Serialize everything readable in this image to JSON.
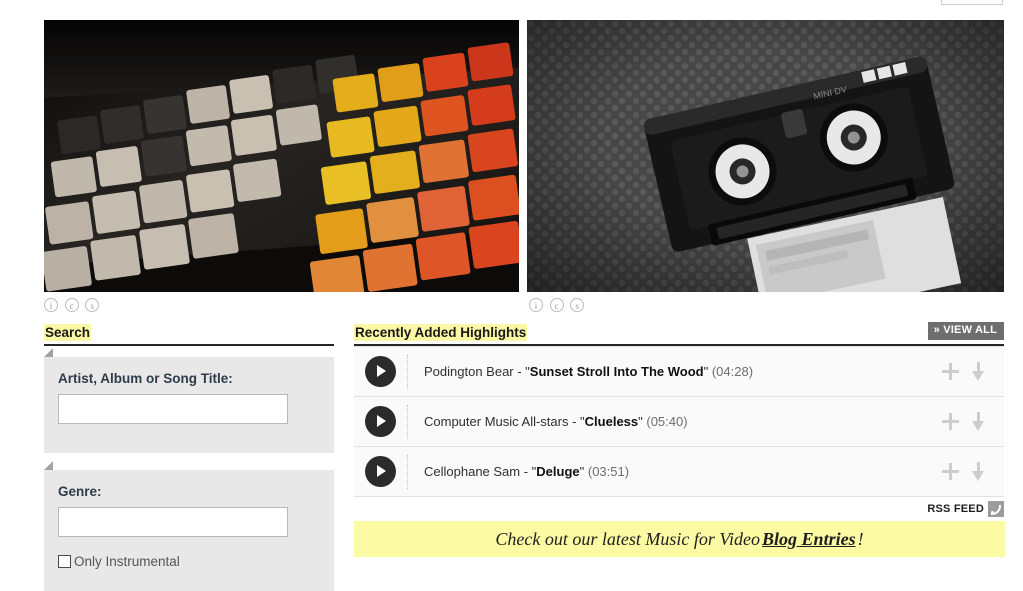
{
  "media": {
    "left_image_alt": "colorful retro keyboard keycaps",
    "right_image_alt": "black mini DV video cassette tape",
    "license_icons": [
      "i",
      "c",
      "s"
    ]
  },
  "search": {
    "heading": "Search",
    "artist_label": "Artist, Album or Song Title:",
    "artist_value": "",
    "artist_placeholder": "",
    "genre_label": "Genre:",
    "genre_value": "",
    "genre_placeholder": "",
    "instrumental_label": "Only Instrumental",
    "instrumental_checked": false
  },
  "recent": {
    "heading": "Recently Added Highlights",
    "view_all_label": "» VIEW ALL",
    "tracks": [
      {
        "artist": "Podington Bear",
        "title": "Sunset Stroll Into The Wood",
        "duration": "(04:28)"
      },
      {
        "artist": "Computer Music All-stars",
        "title": "Clueless",
        "duration": "(05:40)"
      },
      {
        "artist": "Cellophane Sam",
        "title": "Deluge",
        "duration": "(03:51)"
      }
    ],
    "action_add": "+",
    "action_download": "↓"
  },
  "rss": {
    "label": "RSS FEED"
  },
  "blog_banner": {
    "prefix": "Check out our latest Music for Video ",
    "link": "Blog Entries",
    "suffix": "!"
  },
  "colors": {
    "highlight_yellow": "#fbf7a5",
    "banner_yellow": "#fcfaa3",
    "panel_gray": "#e8e8e8",
    "view_all_gray": "#6e6e6e",
    "play_dark": "#2b2b2b",
    "icon_gray": "#cdcdcd"
  }
}
